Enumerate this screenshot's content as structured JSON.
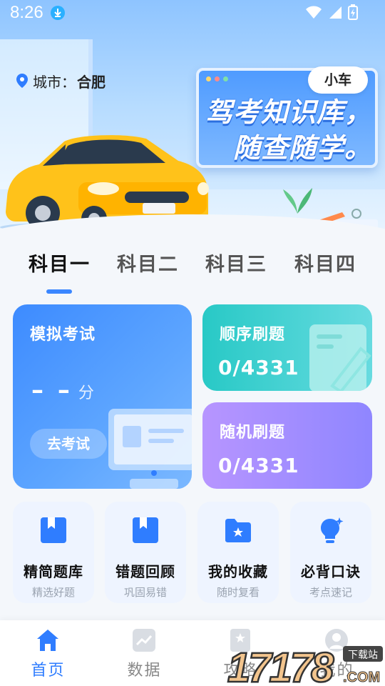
{
  "status_bar": {
    "time": "8:26"
  },
  "header": {
    "city_label": "城市：",
    "city_value": "合肥",
    "vehicle_type": "小车",
    "slogan_line1": "驾考知识库，",
    "slogan_line2": "随查随学。"
  },
  "subject_tabs": [
    {
      "label": "科目一",
      "active": true
    },
    {
      "label": "科目二",
      "active": false
    },
    {
      "label": "科目三",
      "active": false
    },
    {
      "label": "科目四",
      "active": false
    }
  ],
  "cards": {
    "mock_exam": {
      "title": "模拟考试",
      "score": "– –",
      "unit": "分",
      "button": "去考试"
    },
    "sequential": {
      "title": "顺序刷题",
      "progress": "0/4331",
      "done": 0,
      "total": 4331
    },
    "random": {
      "title": "随机刷题",
      "progress": "0/4331",
      "done": 0,
      "total": 4331
    }
  },
  "tools": [
    {
      "name": "精简题库",
      "sub": "精选好题",
      "icon": "bookmark-book-icon"
    },
    {
      "name": "错题回顾",
      "sub": "巩固易错",
      "icon": "bookmark-book-icon"
    },
    {
      "name": "我的收藏",
      "sub": "随时复看",
      "icon": "star-folder-icon"
    },
    {
      "name": "必背口诀",
      "sub": "考点速记",
      "icon": "lightbulb-icon"
    }
  ],
  "bottom_nav": [
    {
      "label": "首页",
      "icon": "home-icon",
      "active": true
    },
    {
      "label": "数据",
      "icon": "chart-icon",
      "active": false
    },
    {
      "label": "攻略",
      "icon": "guide-icon",
      "active": false
    },
    {
      "label": "我的",
      "icon": "profile-icon",
      "active": false
    }
  ],
  "watermark": {
    "text": "17178",
    "suffix": ".COM",
    "badge": "下载站"
  },
  "colors": {
    "accent": "#3a86ff",
    "mock_card": "#4a95ff",
    "seq_card": "#3dd0cf",
    "rand_card": "#a48eff",
    "tool_bg": "#eef4ff",
    "tool_icon": "#2f7dff"
  }
}
